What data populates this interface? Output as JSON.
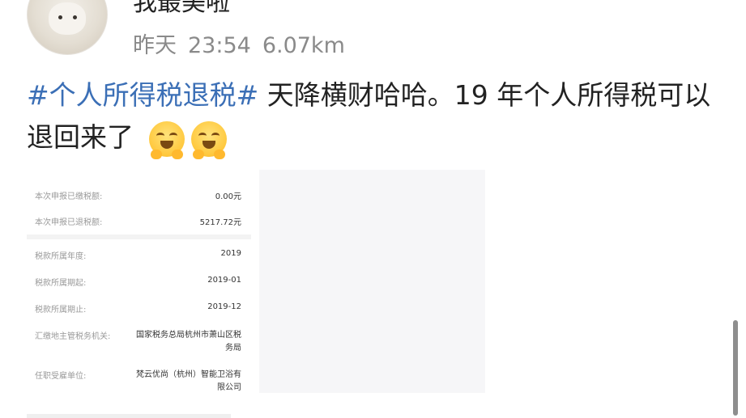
{
  "user": {
    "name": "我最美啦",
    "time_day": "昨天",
    "time_clock": "23:54",
    "distance": "6.07km"
  },
  "post": {
    "hashtag": "#个人所得税退税#",
    "text": " 天降横财哈哈。19 年个人所得税可以退回来了 ",
    "emoji": [
      "hugging-face-emoji",
      "hugging-face-emoji"
    ]
  },
  "tax_record": {
    "rows_top": [
      {
        "label": "本次申报已缴税额:",
        "value": "0.00元"
      },
      {
        "label": "本次申报已退税额:",
        "value": "5217.72元"
      }
    ],
    "rows_bottom": [
      {
        "label": "税款所属年度:",
        "value": "2019"
      },
      {
        "label": "税款所属期起:",
        "value": "2019-01"
      },
      {
        "label": "税款所属期止:",
        "value": "2019-12"
      },
      {
        "label": "汇缴地主管税务机关:",
        "value": "国家税务总局杭州市萧山区税务局"
      },
      {
        "label": "任职受雇单位:",
        "value": "梵云优尚（杭州）智能卫浴有限公司"
      }
    ]
  },
  "colors": {
    "hashtag": "#3b6fb6",
    "text": "#222222",
    "meta": "#8a8a8a"
  }
}
